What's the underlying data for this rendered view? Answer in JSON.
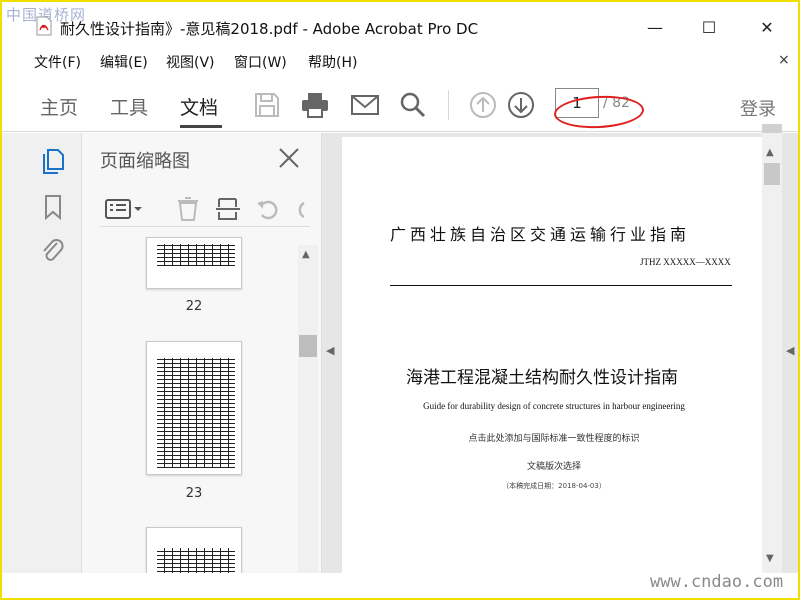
{
  "window": {
    "title": "耐久性设计指南》-意见稿2018.pdf - Adobe Acrobat Pro DC",
    "minimize": "—",
    "maximize": "☐",
    "close": "✕"
  },
  "watermarks": {
    "top_left": "中国道桥网",
    "bottom_right": "www.cndao.com"
  },
  "menu": {
    "items": [
      "文件(F)",
      "编辑(E)",
      "视图(V)",
      "窗口(W)",
      "帮助(H)"
    ],
    "close": "×"
  },
  "toolbar": {
    "tabs": [
      "主页",
      "工具",
      "文档"
    ],
    "active_tab": "文档",
    "current_page": "1",
    "page_total": "/ 82",
    "signin": "登录"
  },
  "sidebar": {
    "title": "页面缩略图",
    "thumbnails": [
      {
        "label": "22"
      },
      {
        "label": "23"
      },
      {
        "label": ""
      }
    ]
  },
  "document": {
    "header": "广西壮族自治区交通运输行业指南",
    "code": "JTHZ  XXXXX—XXXX",
    "title": "海港工程混凝土结构耐久性设计指南",
    "subtitle": "Guide for durability design of concrete structures in harbour engineering",
    "hint": "点击此处添加与国际标准一致性程度的标识",
    "version": "文稿版次选择",
    "date": "（本稿完成日期：2018-04-03）"
  },
  "colors": {
    "frame_border": "#f0e000",
    "annotation": "#e02020"
  }
}
